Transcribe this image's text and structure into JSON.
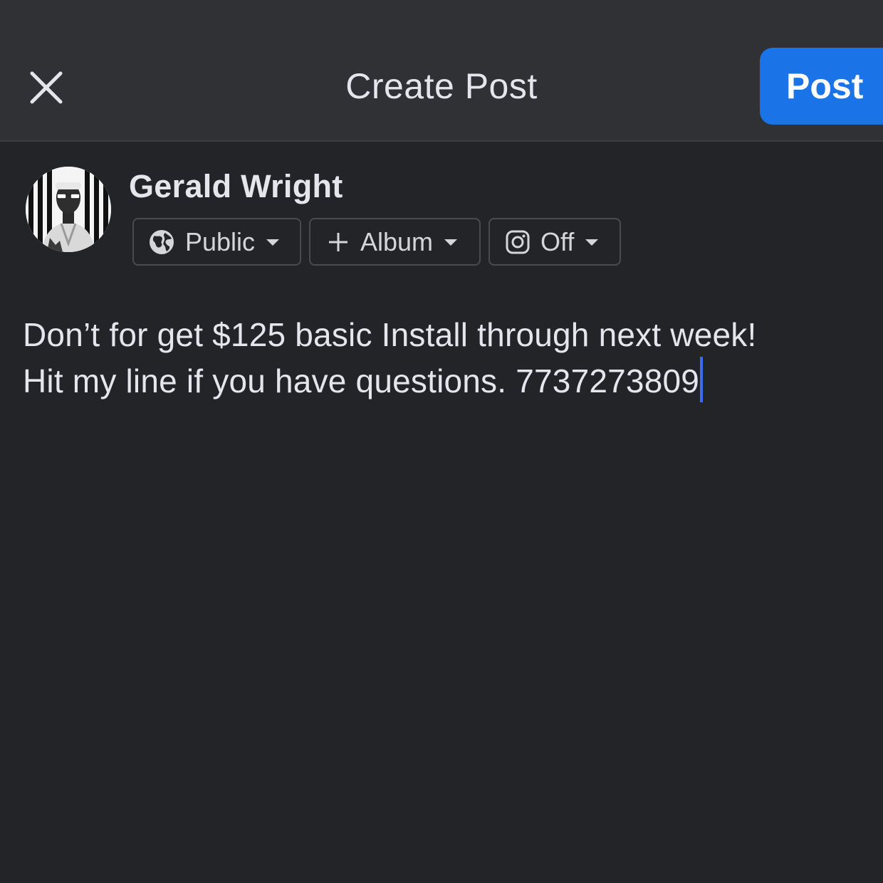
{
  "header": {
    "title": "Create Post",
    "post_label": "Post",
    "close_icon": "close-icon"
  },
  "user": {
    "name": "Gerald Wright",
    "avatar": "profile-photo"
  },
  "chips": {
    "audience": {
      "label": "Public",
      "icon": "globe-icon"
    },
    "album": {
      "label": "Album",
      "icon": "plus-icon"
    },
    "instagram": {
      "label": "Off",
      "icon": "instagram-icon"
    }
  },
  "composer": {
    "line1": "Don’t for get $125 basic Install through next week!",
    "line2": "Hit my line if you have questions. 7737273809"
  },
  "colors": {
    "accent": "#1b73e8",
    "background": "#232427",
    "header": "#303134",
    "cursor": "#3f6bf0"
  }
}
